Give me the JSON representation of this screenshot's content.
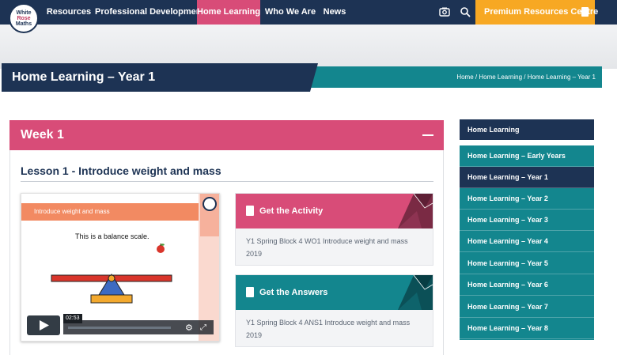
{
  "logo": {
    "line1": "White",
    "line2": "Rose",
    "line3": "Maths"
  },
  "nav": {
    "items": [
      {
        "label": "Resources"
      },
      {
        "label": "Professional Development"
      },
      {
        "label": "Home Learning"
      },
      {
        "label": "Who We Are"
      },
      {
        "label": "News"
      }
    ],
    "active": "Home Learning",
    "icons": [
      "camera-icon",
      "search-icon"
    ],
    "premium_label": "Premium Resources Centre"
  },
  "page_title": "Home Learning – Year 1",
  "breadcrumb": "Home / Home Learning / Home Learning – Year 1",
  "week": {
    "title": "Week 1",
    "lesson_title": "Lesson 1 - Introduce weight and mass",
    "video": {
      "ribbon_title": "Introduce weight and mass",
      "slide_text": "This is a balance scale.",
      "duration": "02:53"
    },
    "activity": {
      "label": "Get the Activity",
      "description": "Y1 Spring Block 4 WO1 Introduce weight and mass 2019"
    },
    "answers": {
      "label": "Get the Answers",
      "description": "Y1 Spring Block 4 ANS1 Introduce weight and mass 2019"
    }
  },
  "sidebar": {
    "heading": "Home Learning",
    "items": [
      {
        "label": "Home Learning – Early Years"
      },
      {
        "label": "Home Learning – Year 1"
      },
      {
        "label": "Home Learning – Year 2"
      },
      {
        "label": "Home Learning – Year 3"
      },
      {
        "label": "Home Learning – Year 4"
      },
      {
        "label": "Home Learning – Year 5"
      },
      {
        "label": "Home Learning – Year 6"
      },
      {
        "label": "Home Learning – Year 7"
      },
      {
        "label": "Home Learning – Year 8"
      }
    ],
    "active": "Home Learning – Year 1"
  },
  "colors": {
    "navy": "#1d3354",
    "pink": "#d84c78",
    "teal": "#13868e",
    "orange": "#f7a823"
  }
}
